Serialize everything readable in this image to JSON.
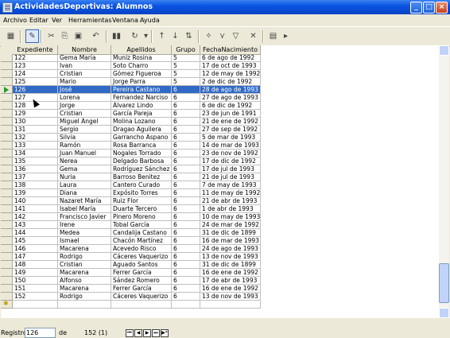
{
  "window": {
    "title": "ActividadesDeportivas: Alumnos"
  },
  "menu": [
    "Archivo",
    "Editar",
    "Ver",
    "Herramientas",
    "Ventana",
    "Ayuda"
  ],
  "columns": [
    "Expediente",
    "Nombre",
    "Apellidos",
    "Grupo",
    "FechaNacimiento"
  ],
  "rows": [
    [
      "122",
      "Gema María",
      "Muniz Rosina",
      "5",
      "6 de ago de 1992"
    ],
    [
      "123",
      "Ivan",
      "Soto Charro",
      "5",
      "17 de oct de 1993"
    ],
    [
      "124",
      "Cristian",
      "Gómez Figueroa",
      "5",
      "12 de may de 1992"
    ],
    [
      "125",
      "Mario",
      "Jorge Parra",
      "5",
      "2 de dic de 1992"
    ],
    [
      "126",
      "José",
      "Pereira Castano",
      "6",
      "28 de ago de 1993"
    ],
    [
      "127",
      "Lorena",
      "Fernandez Narciso",
      "6",
      "27 de ago de 1993"
    ],
    [
      "128",
      "Jorge",
      "Álvarez Lindo",
      "6",
      "6 de dic de 1992"
    ],
    [
      "129",
      "Cristian",
      "García Pareja",
      "6",
      "23 de jun de 1991"
    ],
    [
      "130",
      "Miguel Ángel",
      "Molina Lozano",
      "6",
      "21 de ene de 1992"
    ],
    [
      "131",
      "Sergio",
      "Dragao Aguilera",
      "6",
      "27 de sep de 1992"
    ],
    [
      "132",
      "Silvia",
      "Garrancho Aspano",
      "6",
      "5 de mar de 1993"
    ],
    [
      "133",
      "Ramón",
      "Rosa Barranca",
      "6",
      "14 de mar de 1993"
    ],
    [
      "134",
      "Juan Manuel",
      "Nogales Torrado",
      "6",
      "23 de nov de 1992"
    ],
    [
      "135",
      "Nerea",
      "Delgado Barbosa",
      "6",
      "17 de dic de 1992"
    ],
    [
      "136",
      "Gema",
      "Rodríguez Sánchez",
      "6",
      "17 de jul de 1993"
    ],
    [
      "137",
      "Nuria",
      "Barroso Benitez",
      "6",
      "21 de jul de 1993"
    ],
    [
      "138",
      "Laura",
      "Cantero Curado",
      "6",
      "7 de may de 1993"
    ],
    [
      "139",
      "Diana",
      "Expósito Torres",
      "6",
      "11 de may de 1992"
    ],
    [
      "140",
      "Nazaret María",
      "Ruiz Flor",
      "6",
      "21 de abr de 1993"
    ],
    [
      "141",
      "Isabel María",
      "Duarte Tercero",
      "6",
      "1 de abr de 1993"
    ],
    [
      "142",
      "Francisco Javier",
      "Pinero Moreno",
      "6",
      "10 de may de 1993"
    ],
    [
      "143",
      "Irene",
      "Tobal García",
      "6",
      "24 de mar de 1992"
    ],
    [
      "144",
      "Medea",
      "Candalija Castano",
      "6",
      "31 de dic de 1899"
    ],
    [
      "145",
      "Ismael",
      "Chacón Martínez",
      "6",
      "16 de mar de 1993"
    ],
    [
      "146",
      "Macarena",
      "Acevedo Risco",
      "6",
      "24 de ago de 1993"
    ],
    [
      "147",
      "Rodrigo",
      "Cáceres Vaquerizo",
      "6",
      "13 de nov de 1993"
    ],
    [
      "148",
      "Cristian",
      "Aguado Santos",
      "6",
      "31 de dic de 1899"
    ],
    [
      "149",
      "Macarena",
      "Ferrer García",
      "6",
      "16 de ene de 1992"
    ],
    [
      "150",
      "Alfonso",
      "Sández Romero",
      "6",
      "17 de abr de 1993"
    ],
    [
      "151",
      "Macarena",
      "Ferrer García",
      "6",
      "16 de ene de 1992"
    ],
    [
      "152",
      "Rodrigo",
      "Cáceres Vaquerizo",
      "6",
      "13 de nov de 1993"
    ]
  ],
  "selected_index": 4,
  "status": {
    "label": "Registro",
    "current": "126",
    "of_label": "de",
    "total": "152 (1)"
  }
}
